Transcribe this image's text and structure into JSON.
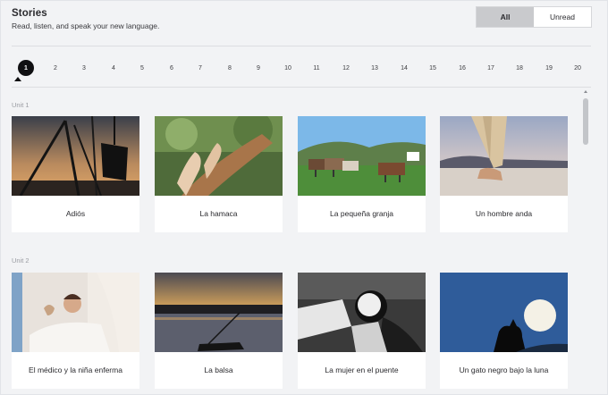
{
  "header": {
    "title": "Stories",
    "subtitle": "Read, listen, and speak your new language."
  },
  "filter": {
    "options": [
      "All",
      "Unread"
    ],
    "selected": "All"
  },
  "pager": {
    "pages": [
      "1",
      "2",
      "3",
      "4",
      "5",
      "6",
      "7",
      "8",
      "9",
      "10",
      "11",
      "12",
      "13",
      "14",
      "15",
      "16",
      "17",
      "18",
      "19",
      "20"
    ],
    "current": "1"
  },
  "units": [
    {
      "label": "Unit 1",
      "stories": [
        {
          "title": "Adiós"
        },
        {
          "title": "La hamaca"
        },
        {
          "title": "La pequeña granja"
        },
        {
          "title": "Un hombre anda"
        }
      ]
    },
    {
      "label": "Unit 2",
      "stories": [
        {
          "title": "El médico y la niña enferma"
        },
        {
          "title": "La balsa"
        },
        {
          "title": "La mujer en el puente"
        },
        {
          "title": "Un gato negro bajo la luna"
        }
      ]
    }
  ],
  "colors": {
    "accent": "#101012",
    "background": "#f2f3f5",
    "selected_toggle": "#c9cacd"
  }
}
